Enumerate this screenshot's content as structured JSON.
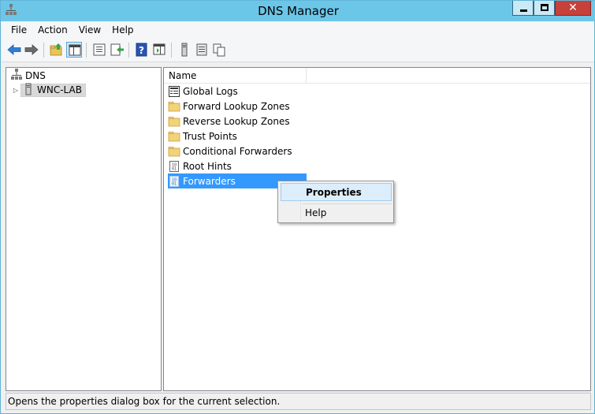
{
  "window": {
    "title": "DNS Manager",
    "close_glyph": "✕",
    "accent_color": "#6cc6e8",
    "icons": {
      "app": "dns-tree-icon",
      "minimize": "minimize-icon",
      "maximize": "maximize-icon",
      "close": "close-icon"
    }
  },
  "menubar": {
    "items": [
      "File",
      "Action",
      "View",
      "Help"
    ]
  },
  "toolbar": {
    "buttons": [
      "back-arrow-icon",
      "forward-arrow-icon",
      "up-folder-icon",
      "show-console-tree-icon",
      "properties-icon",
      "export-list-icon",
      "help-icon",
      "show-action-pane-icon",
      "server-icon",
      "list-icon",
      "copy-icon"
    ]
  },
  "tree": {
    "root_label": "DNS",
    "server_label": "WNC-LAB",
    "expander_glyph": "▷"
  },
  "list": {
    "column_name": "Name",
    "items": [
      {
        "label": "Global Logs",
        "icon": "log-viewer-icon"
      },
      {
        "label": "Forward Lookup Zones",
        "icon": "folder-icon"
      },
      {
        "label": "Reverse Lookup Zones",
        "icon": "folder-icon"
      },
      {
        "label": "Trust Points",
        "icon": "folder-icon"
      },
      {
        "label": "Conditional Forwarders",
        "icon": "folder-icon"
      },
      {
        "label": "Root Hints",
        "icon": "binary-document-icon"
      },
      {
        "label": "Forwarders",
        "icon": "binary-document-icon",
        "selected": true
      }
    ]
  },
  "context_menu": {
    "items": [
      "Properties",
      "Help"
    ],
    "highlighted": "Properties"
  },
  "statusbar": {
    "text": "Opens the properties dialog box for the current selection."
  },
  "colors": {
    "selection": "#3399ff",
    "titlebar": "#6cc6e8",
    "close_button": "#c7403a"
  }
}
